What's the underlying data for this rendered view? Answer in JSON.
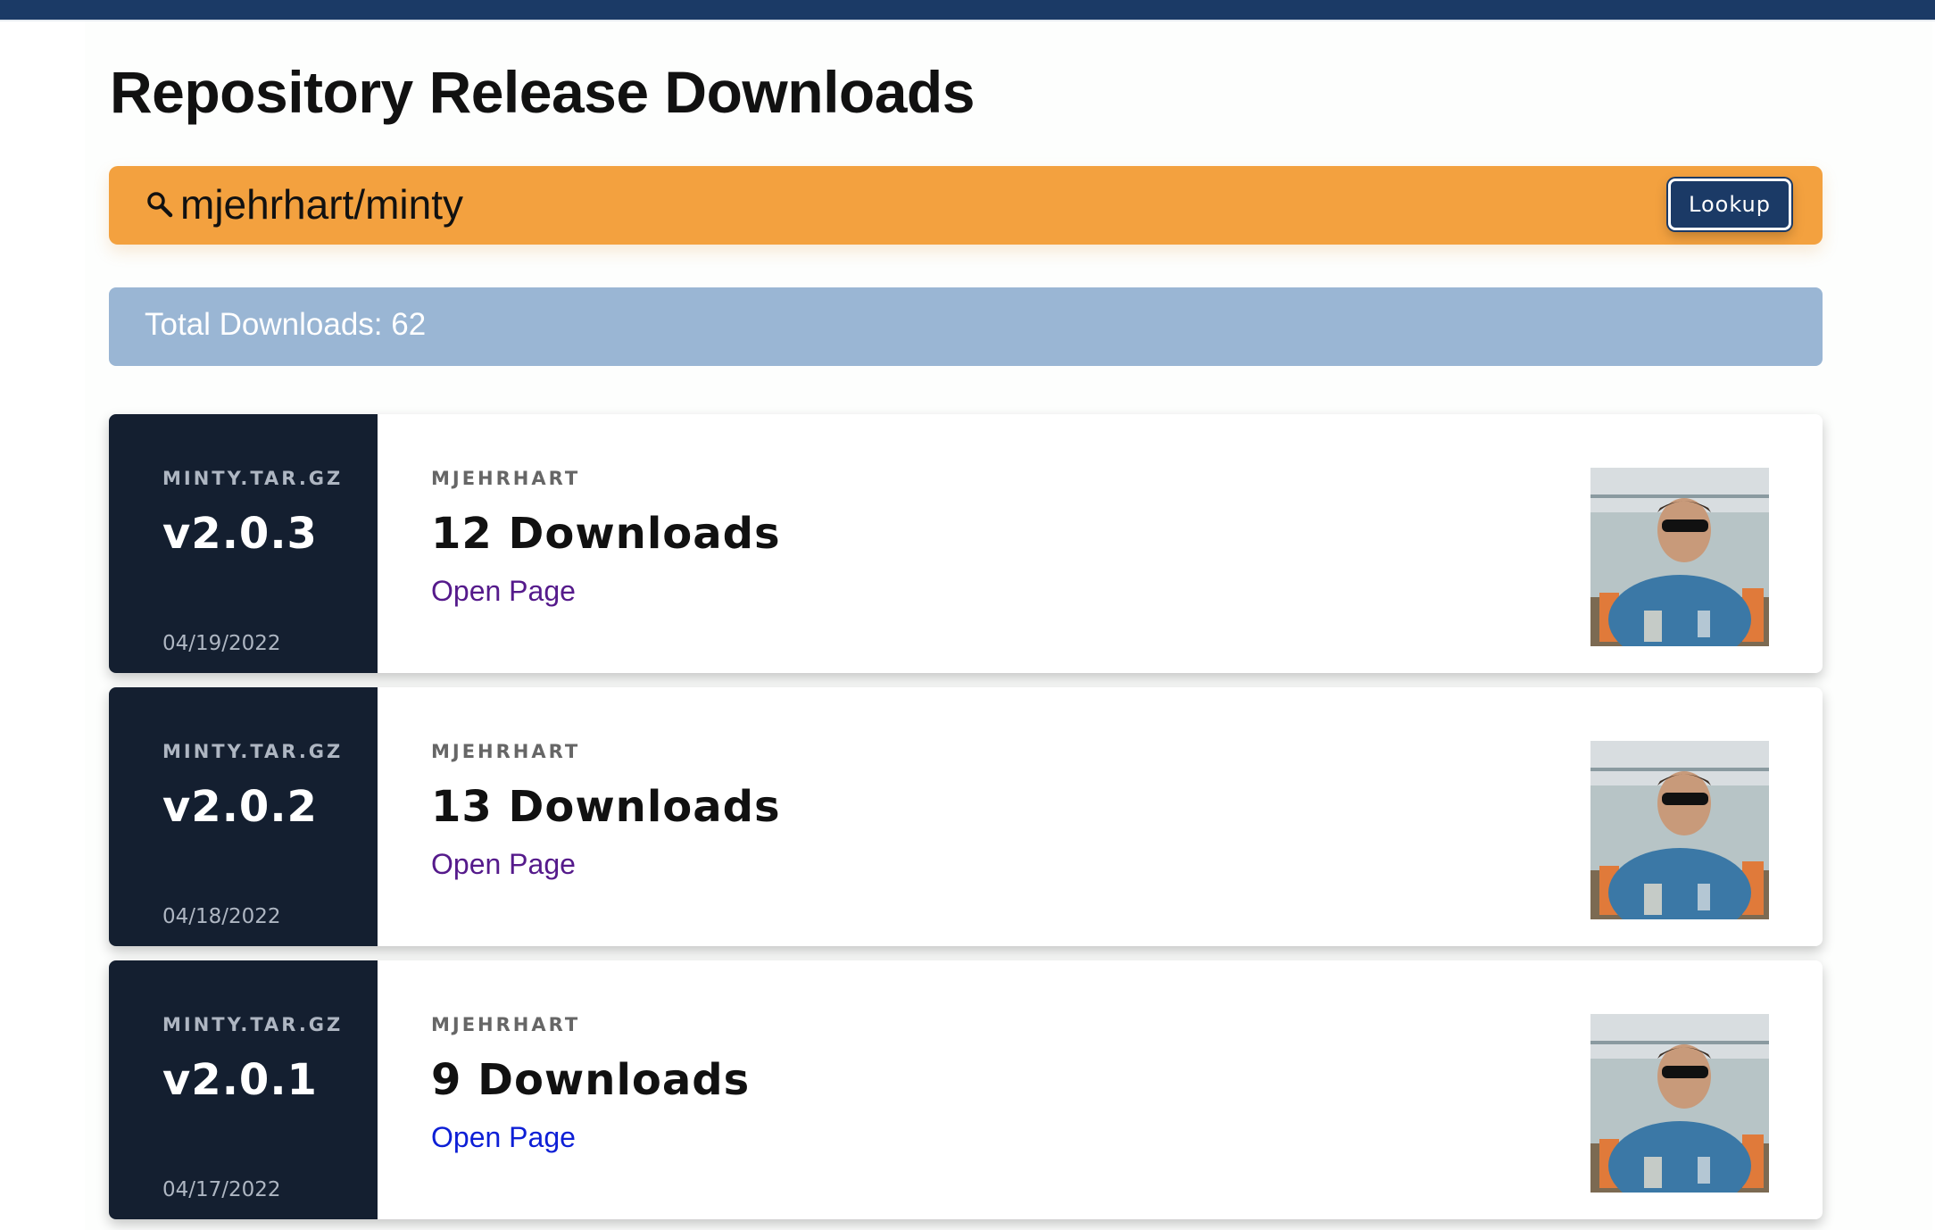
{
  "header": {
    "title": "Repository Release Downloads"
  },
  "search": {
    "value": "mjehrhart/minty",
    "button_label": "Lookup",
    "icon": "search-icon"
  },
  "summary": {
    "total_label": "Total Downloads: 62"
  },
  "colors": {
    "top_bar": "#1b3a66",
    "search_bar": "#f3a13f",
    "button": "#1b3a66",
    "total_banner": "#9ab6d4",
    "card_side": "#141f30",
    "link_visited": "#551a8b",
    "link_unvisited": "#0d1fd6"
  },
  "releases": [
    {
      "asset": "MINTY.TAR.GZ",
      "version": "v2.0.3",
      "date": "04/19/2022",
      "author": "MJEHRHART",
      "downloads": "12 Downloads",
      "link_label": "Open Page",
      "link_visited": true
    },
    {
      "asset": "MINTY.TAR.GZ",
      "version": "v2.0.2",
      "date": "04/18/2022",
      "author": "MJEHRHART",
      "downloads": "13 Downloads",
      "link_label": "Open Page",
      "link_visited": true
    },
    {
      "asset": "MINTY.TAR.GZ",
      "version": "v2.0.1",
      "date": "04/17/2022",
      "author": "MJEHRHART",
      "downloads": "9 Downloads",
      "link_label": "Open Page",
      "link_visited": false
    }
  ]
}
